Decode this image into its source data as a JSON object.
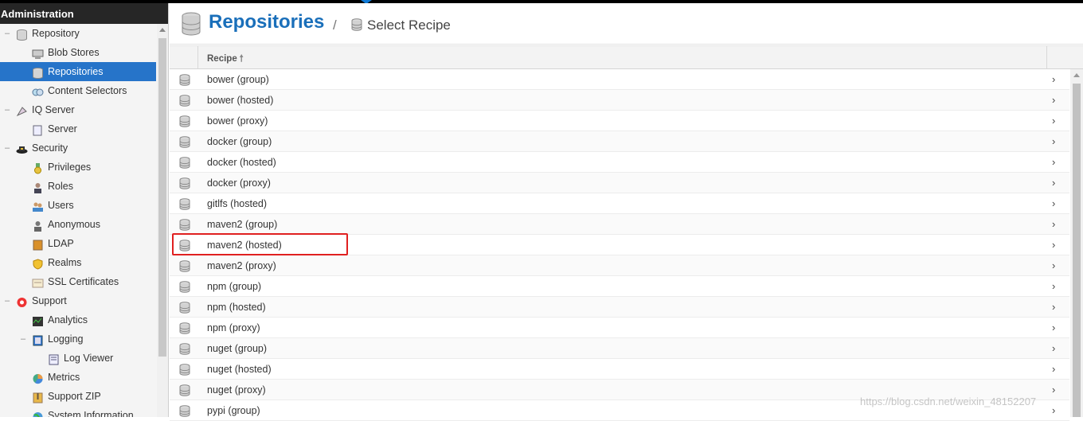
{
  "sidebar": {
    "header": "Administration",
    "items": [
      {
        "label": "Repository",
        "level": 0,
        "toggle": "–",
        "icon": "database-icon"
      },
      {
        "label": "Blob Stores",
        "level": 1,
        "toggle": "",
        "icon": "server-icon"
      },
      {
        "label": "Repositories",
        "level": 1,
        "toggle": "",
        "icon": "database-icon",
        "selected": true
      },
      {
        "label": "Content Selectors",
        "level": 1,
        "toggle": "",
        "icon": "content-selector-icon"
      },
      {
        "label": "IQ Server",
        "level": 0,
        "toggle": "–",
        "icon": "iq-server-icon"
      },
      {
        "label": "Server",
        "level": 1,
        "toggle": "",
        "icon": "document-icon"
      },
      {
        "label": "Security",
        "level": 0,
        "toggle": "–",
        "icon": "security-hat-icon"
      },
      {
        "label": "Privileges",
        "level": 1,
        "toggle": "",
        "icon": "medal-icon"
      },
      {
        "label": "Roles",
        "level": 1,
        "toggle": "",
        "icon": "role-user-icon"
      },
      {
        "label": "Users",
        "level": 1,
        "toggle": "",
        "icon": "users-icon"
      },
      {
        "label": "Anonymous",
        "level": 1,
        "toggle": "",
        "icon": "anonymous-user-icon"
      },
      {
        "label": "LDAP",
        "level": 1,
        "toggle": "",
        "icon": "address-book-icon"
      },
      {
        "label": "Realms",
        "level": 1,
        "toggle": "",
        "icon": "shield-icon"
      },
      {
        "label": "SSL Certificates",
        "level": 1,
        "toggle": "",
        "icon": "certificate-icon"
      },
      {
        "label": "Support",
        "level": 0,
        "toggle": "–",
        "icon": "lifebuoy-icon"
      },
      {
        "label": "Analytics",
        "level": 1,
        "toggle": "",
        "icon": "chart-icon"
      },
      {
        "label": "Logging",
        "level": 1,
        "toggle": "–",
        "icon": "log-icon"
      },
      {
        "label": "Log Viewer",
        "level": 2,
        "toggle": "",
        "icon": "log-viewer-icon"
      },
      {
        "label": "Metrics",
        "level": 1,
        "toggle": "",
        "icon": "pie-chart-icon"
      },
      {
        "label": "Support ZIP",
        "level": 1,
        "toggle": "",
        "icon": "zip-icon"
      },
      {
        "label": "System Information",
        "level": 1,
        "toggle": "",
        "icon": "globe-icon"
      }
    ]
  },
  "header": {
    "title": "Repositories",
    "separator": "/",
    "breadcrumb": "Select Recipe"
  },
  "grid": {
    "column_recipe": "Recipe",
    "sort_indicator": "🠕",
    "rows": [
      "bower (group)",
      "bower (hosted)",
      "bower (proxy)",
      "docker (group)",
      "docker (hosted)",
      "docker (proxy)",
      "gitlfs (hosted)",
      "maven2 (group)",
      "maven2 (hosted)",
      "maven2 (proxy)",
      "npm (group)",
      "npm (hosted)",
      "npm (proxy)",
      "nuget (group)",
      "nuget (hosted)",
      "nuget (proxy)",
      "pypi (group)"
    ],
    "highlighted_row": "maven2 (hosted)",
    "chevron": "›"
  },
  "watermark": "https://blog.csdn.net/weixin_48152207",
  "colors": {
    "accent": "#2674c9",
    "title": "#1a6fba",
    "header_bg": "#262626",
    "highlight_border": "#e02020"
  }
}
